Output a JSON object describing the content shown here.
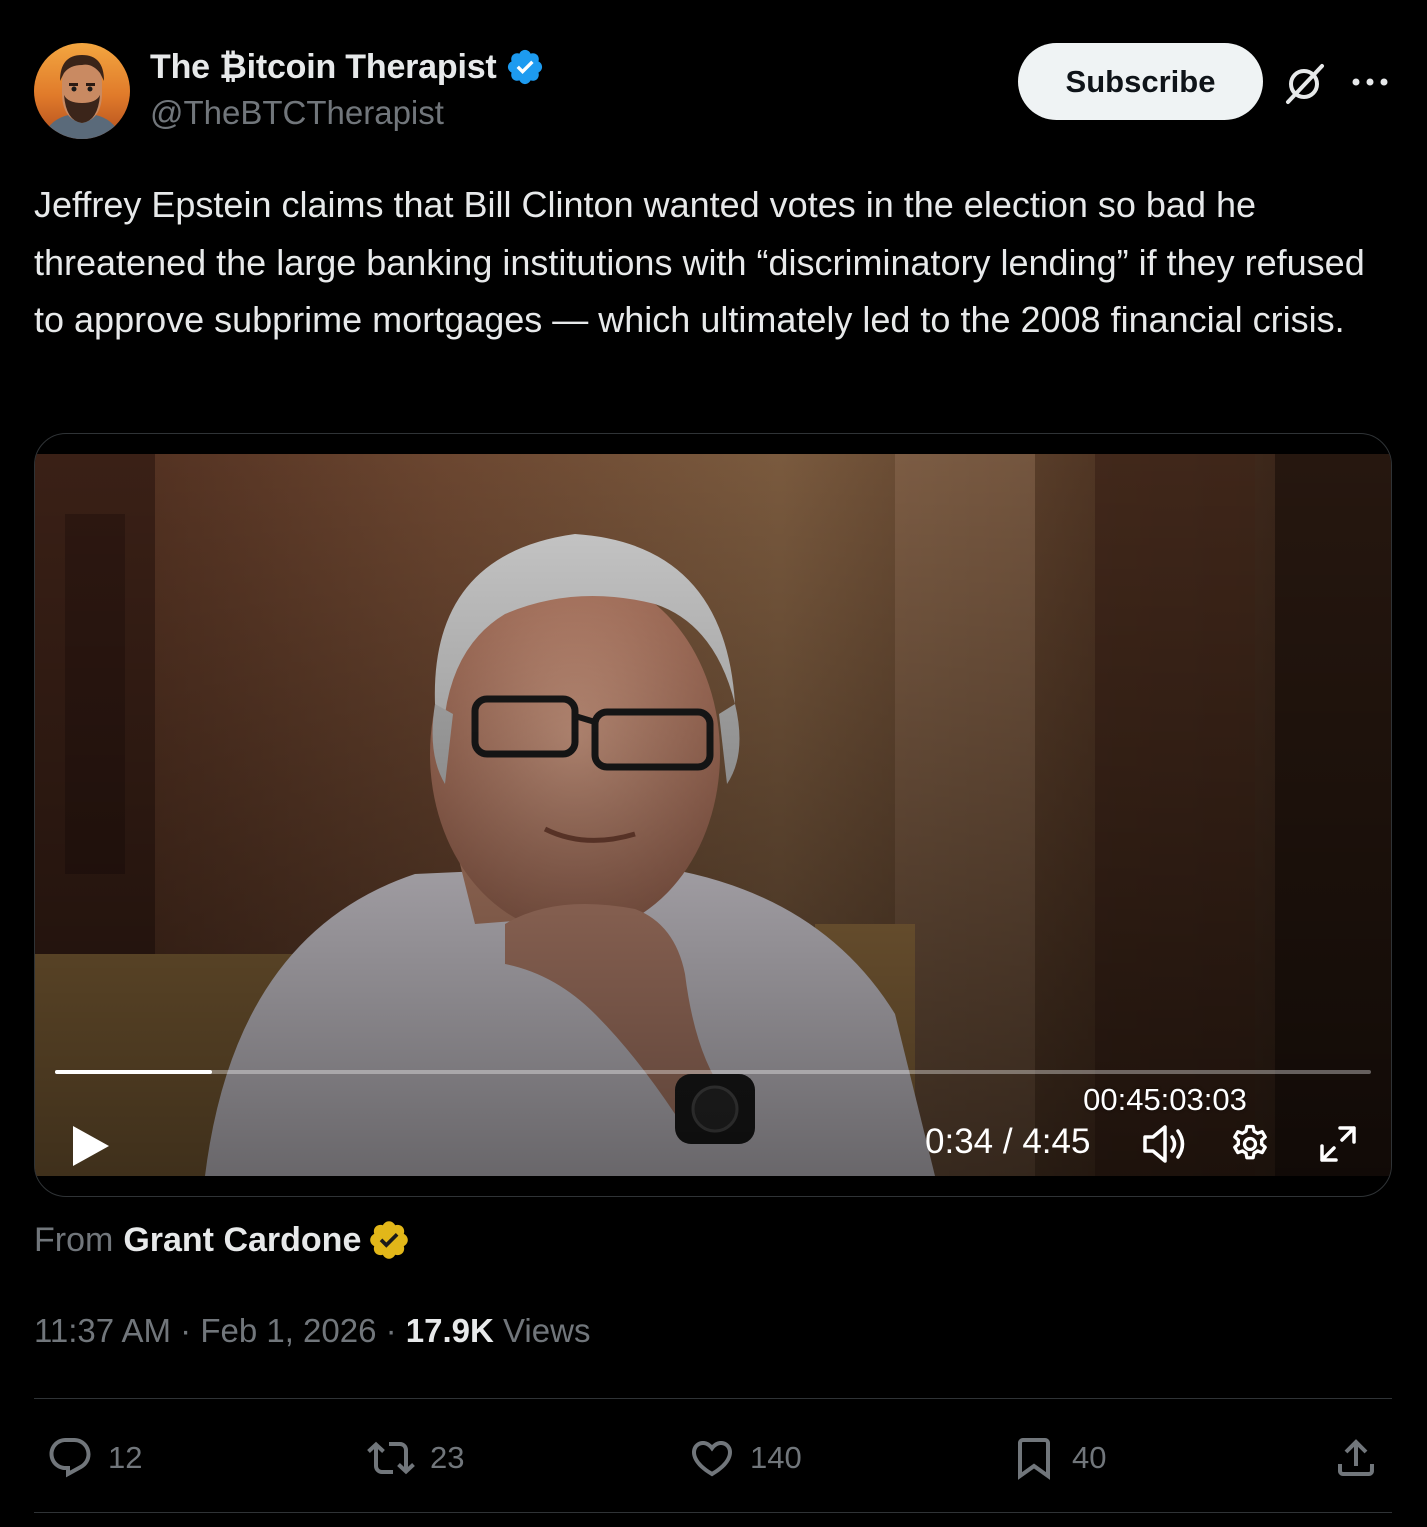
{
  "author": {
    "display_name": "The ₿itcoin Therapist",
    "handle": "@TheBTCTherapist",
    "verified": "blue-check-icon"
  },
  "header": {
    "subscribe_label": "Subscribe",
    "grok_icon": "grok-slash-icon",
    "more_icon": "ellipsis-icon"
  },
  "tweet": {
    "text": "Jeffrey Epstein claims that Bill Clinton wanted votes in the election so bad he threatened the large banking institutions with “discriminatory lending” if they refused to approve subprime mortgages — which ultimately led to the 2008 financial crisis."
  },
  "video": {
    "timecode_overlay": "00:45:03:03",
    "current_time": "0:34",
    "separator": " / ",
    "duration": "4:45",
    "progress_fraction": 0.119,
    "controls": [
      "play-icon",
      "volume-icon",
      "settings-gear-icon",
      "fullscreen-expand-icon"
    ]
  },
  "attribution": {
    "from_label": "From",
    "source_name": "Grant Cardone",
    "badge": "gold-verified-icon"
  },
  "meta": {
    "time": "11:37 AM",
    "dot": " · ",
    "date": "Feb 1, 2026",
    "views_count": "17.9K",
    "views_label": " Views"
  },
  "actions": {
    "replies": "12",
    "reposts": "23",
    "likes": "140",
    "bookmarks": "40"
  },
  "colors": {
    "background": "#000000",
    "text_primary": "#e7e9ea",
    "text_secondary": "#71767b",
    "verified_blue": "#1d9bf0",
    "verified_gold": "#e2b719",
    "divider": "#2f3336"
  }
}
